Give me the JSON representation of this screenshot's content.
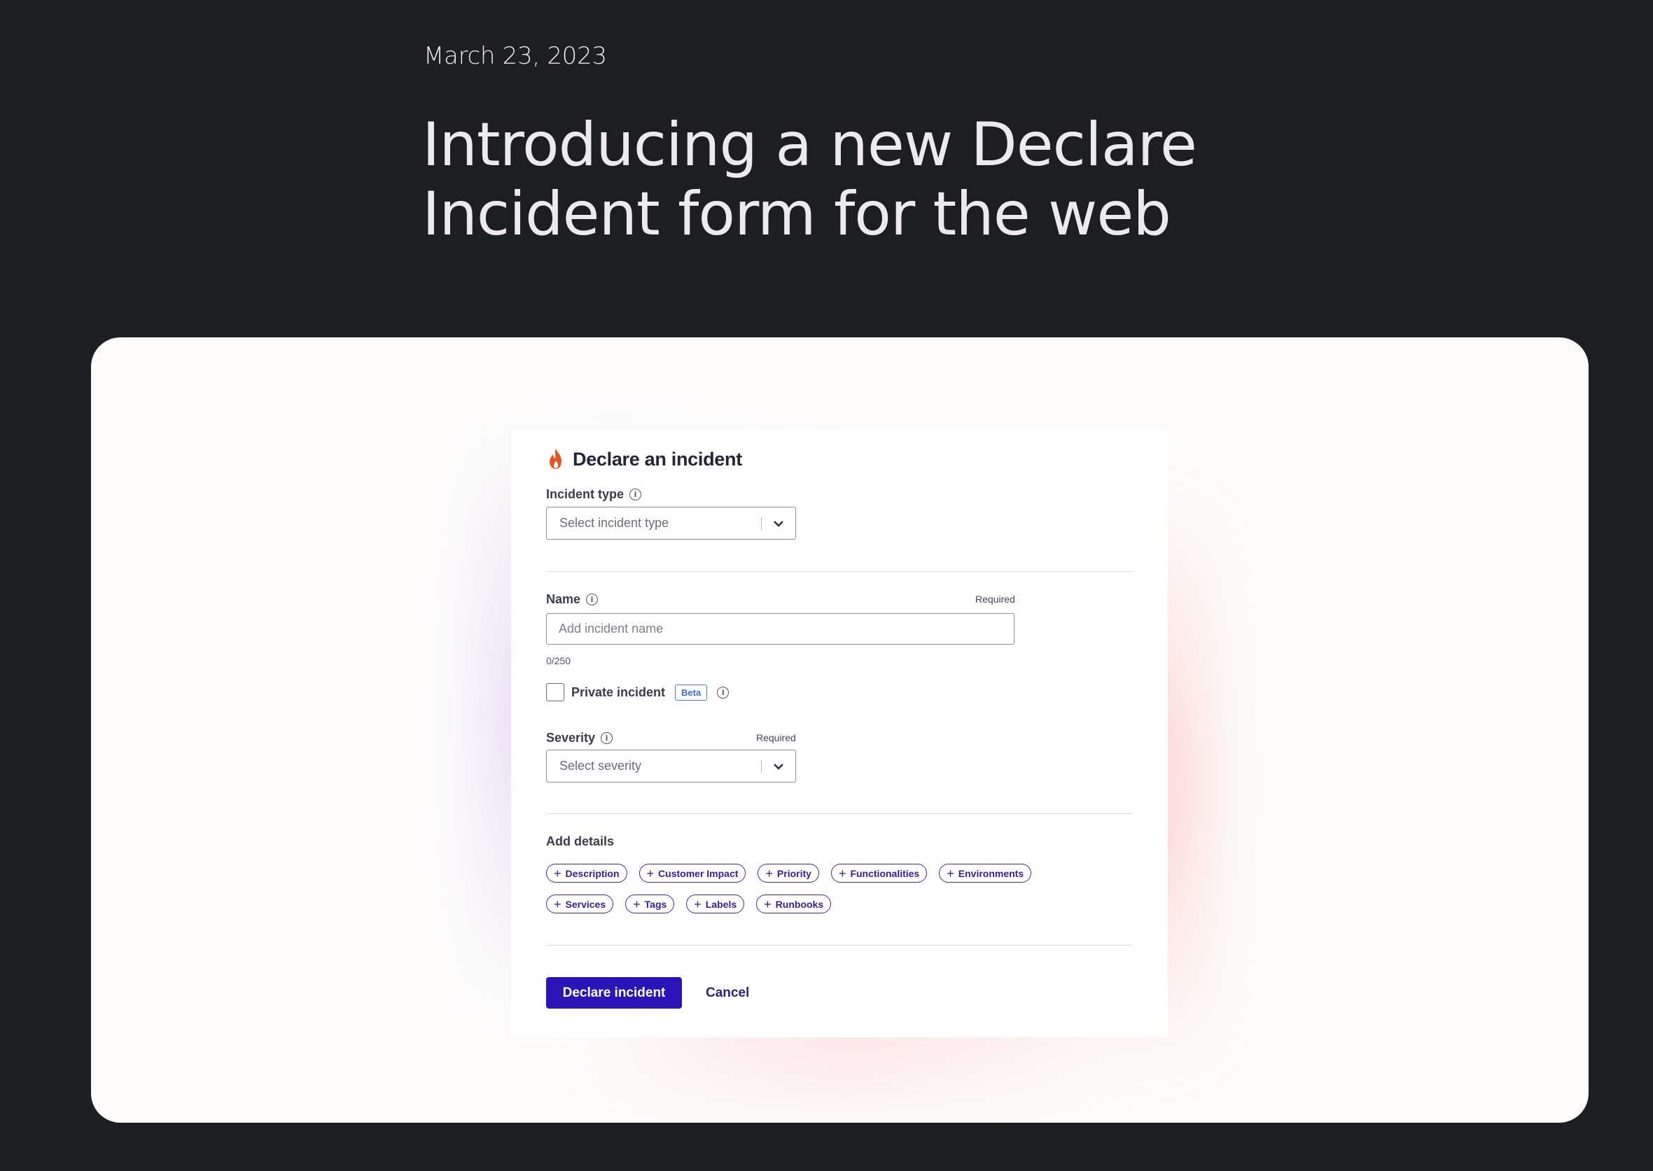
{
  "post": {
    "date": "March 23, 2023",
    "title_line1": "Introducing a new Declare",
    "title_line2": "Incident form for the web"
  },
  "modal": {
    "title": "Declare an incident",
    "title_icon": "fire-icon",
    "incident_type": {
      "label": "Incident type",
      "value": "Select incident type"
    },
    "name": {
      "label": "Name",
      "required": "Required",
      "placeholder": "Add incident name",
      "char_count": "0/250"
    },
    "private_incident": {
      "label": "Private incident",
      "badge": "Beta",
      "checked": false
    },
    "severity": {
      "label": "Severity",
      "required": "Required",
      "value": "Select severity"
    },
    "add_details": {
      "title": "Add details",
      "row1": [
        "Description",
        "Customer Impact",
        "Priority",
        "Functionalities",
        "Environments"
      ],
      "row2": [
        "Services",
        "Tags",
        "Labels",
        "Runbooks"
      ]
    },
    "buttons": {
      "declare": "Declare incident",
      "cancel": "Cancel"
    }
  },
  "colors": {
    "page_bg": "#1d1e22",
    "card_bg": "#fcfbfa",
    "primary": "#2a14b8",
    "fire": "#e8531f",
    "beta": "#3a6bd6"
  }
}
